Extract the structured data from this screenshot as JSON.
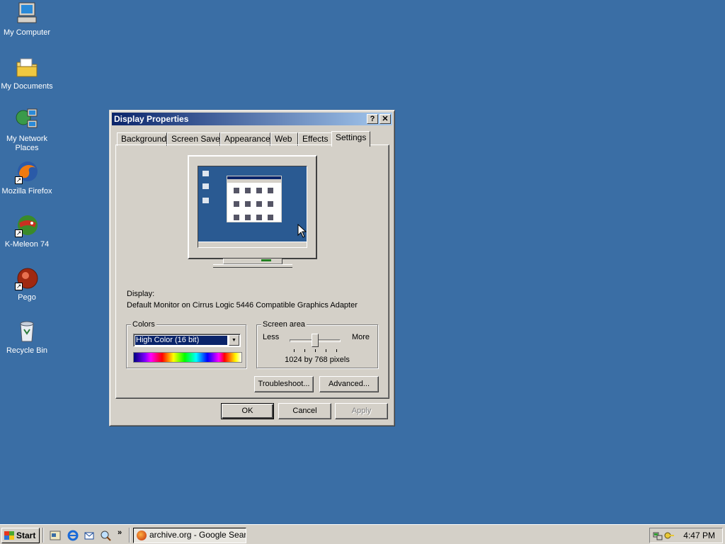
{
  "desktop": {
    "background_color": "#3a6ea5",
    "icons": [
      {
        "label": "My Computer",
        "icon": "my-computer-icon"
      },
      {
        "label": "My Documents",
        "icon": "my-documents-icon"
      },
      {
        "label": "My Network Places",
        "icon": "network-places-icon"
      },
      {
        "label": "Mozilla Firefox",
        "icon": "firefox-icon"
      },
      {
        "label": "K-Meleon 74",
        "icon": "k-meleon-icon"
      },
      {
        "label": "Pego",
        "icon": "pego-icon"
      },
      {
        "label": "Recycle Bin",
        "icon": "recycle-bin-icon"
      }
    ]
  },
  "window": {
    "title": "Display Properties",
    "help_button": "?",
    "close_button": "✕",
    "tabs": [
      "Background",
      "Screen Saver",
      "Appearance",
      "Web",
      "Effects",
      "Settings"
    ],
    "active_tab": "Settings",
    "display_label": "Display:",
    "display_value": "Default Monitor on Cirrus Logic 5446 Compatible Graphics Adapter",
    "colors": {
      "legend": "Colors",
      "selected": "High Color (16 bit)"
    },
    "screen_area": {
      "legend": "Screen area",
      "less": "Less",
      "more": "More",
      "slider_position": 0.5,
      "resolution": "1024 by 768 pixels"
    },
    "buttons": {
      "troubleshoot": "Troubleshoot...",
      "advanced": "Advanced...",
      "ok": "OK",
      "cancel": "Cancel",
      "apply": "Apply"
    }
  },
  "taskbar": {
    "start_label": "Start",
    "more_indicator": "»",
    "task_button": "archive.org - Google Searc...",
    "clock": "4:47 PM"
  }
}
